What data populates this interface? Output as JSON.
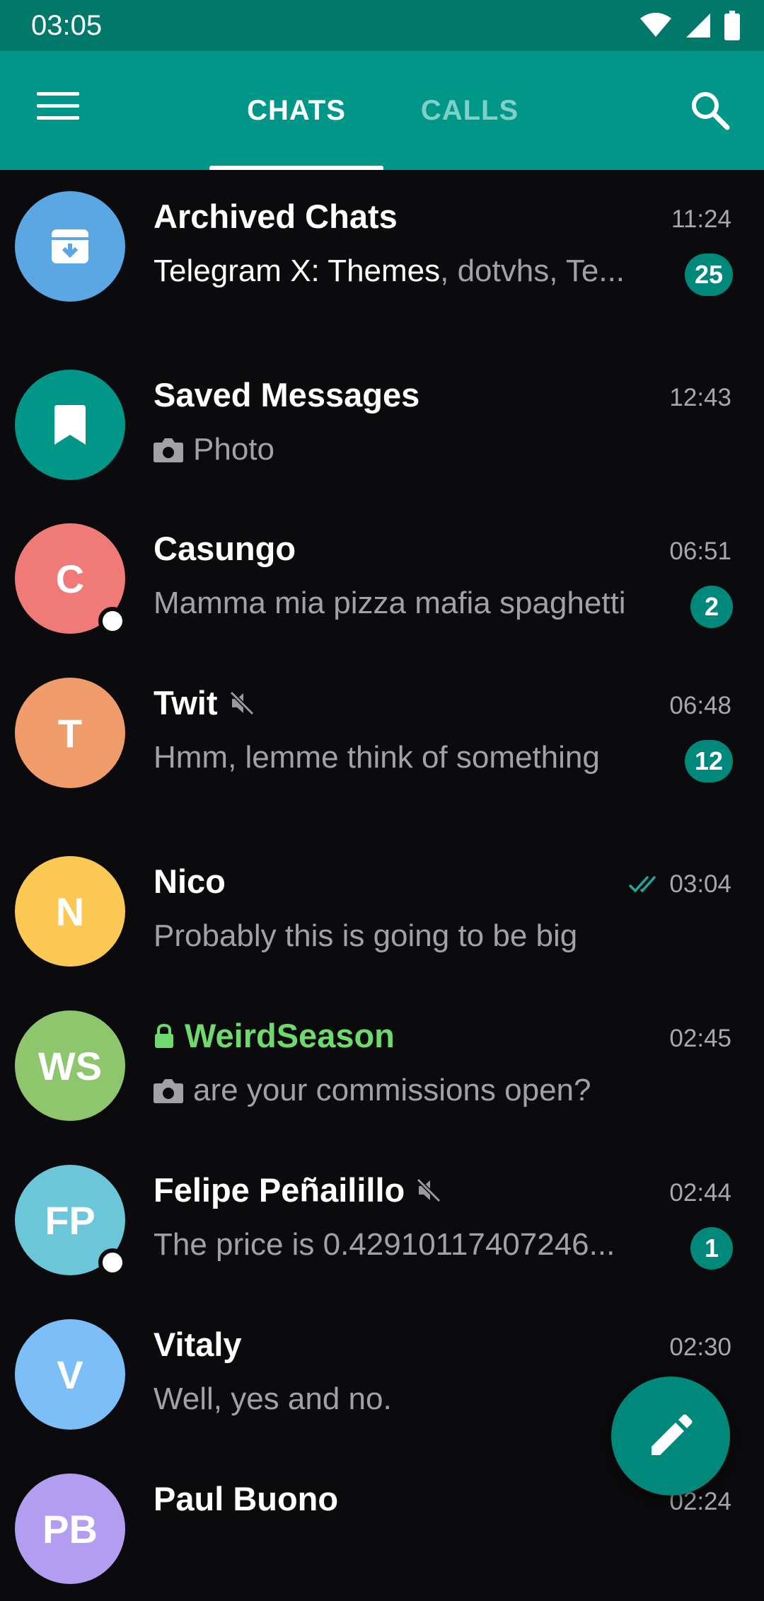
{
  "status_bar": {
    "time": "03:05"
  },
  "tabs": {
    "chats": "CHATS",
    "calls": "CALLS"
  },
  "colors": {
    "app_bar": "#009688",
    "accent": "#00897b",
    "secret_green": "#6fd96f"
  },
  "chats": [
    {
      "name": "Archived Chats",
      "time": "11:24",
      "preview_highlight": "Telegram X: Themes",
      "preview": ", dotvhs, Te...",
      "badge": "25",
      "avatar_icon": "archive-icon",
      "avatar_color": "#5aa7e3"
    },
    {
      "name": "Saved Messages",
      "time": "12:43",
      "preview": "Photo",
      "preview_icon": "camera-icon",
      "avatar_icon": "bookmark-icon",
      "avatar_color": "#009688"
    },
    {
      "name": "Casungo",
      "initials": "C",
      "time": "06:51",
      "preview": "Mamma mia pizza mafia spaghetti",
      "badge": "2",
      "avatar_color": "#ef7a78",
      "online": true
    },
    {
      "name": "Twit",
      "initials": "T",
      "time": "06:48",
      "preview": "Hmm, lemme think of something",
      "badge": "12",
      "muted": true,
      "avatar_color": "#f19c6b"
    },
    {
      "name": "Nico",
      "initials": "N",
      "time": "03:04",
      "preview": "Probably this is going to be big",
      "read_receipt": "double-check-icon",
      "avatar_color": "#fbc853"
    },
    {
      "name": "WeirdSeason",
      "initials": "WS",
      "time": "02:45",
      "preview": "are your commissions open?",
      "preview_icon": "camera-icon",
      "secret": true,
      "avatar_color": "#8dc66d"
    },
    {
      "name": "Felipe Peñailillo",
      "initials": "FP",
      "time": "02:44",
      "preview": "The price is 0.42910117407246...",
      "badge": "1",
      "muted": true,
      "avatar_color": "#6ac6d8",
      "online": true
    },
    {
      "name": "Vitaly",
      "initials": "V",
      "time": "02:30",
      "preview": "Well, yes and no.",
      "avatar_color": "#7cbef8"
    },
    {
      "name": "Paul Buono",
      "initials": "PB",
      "time": "02:24",
      "avatar_color": "#b39df0"
    }
  ],
  "fab": {
    "icon": "pencil-icon"
  }
}
